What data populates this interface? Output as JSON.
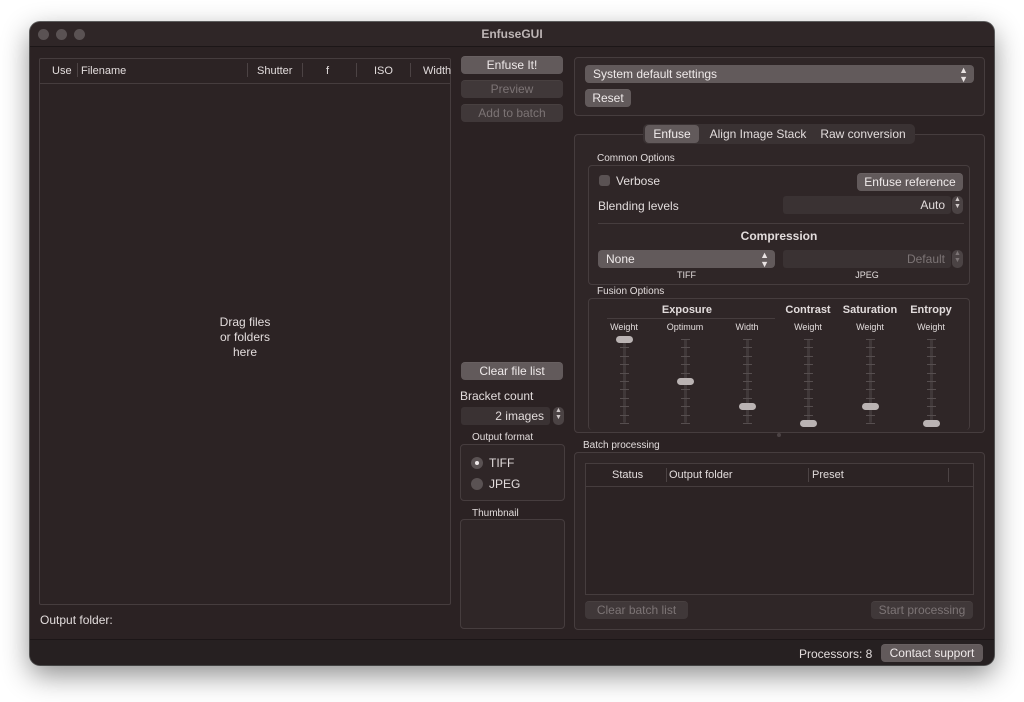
{
  "window": {
    "title": "EnfuseGUI"
  },
  "file_table": {
    "columns": [
      "Use",
      "Filename",
      "Shutter",
      "f",
      "ISO",
      "Width"
    ],
    "drop_hint": [
      "Drag files",
      "or folders",
      "here"
    ]
  },
  "output_folder_label": "Output folder:",
  "actions": {
    "enfuse": "Enfuse It!",
    "preview": "Preview",
    "add_to_batch": "Add to batch",
    "clear_file_list": "Clear file list"
  },
  "bracket": {
    "label": "Bracket count",
    "value": "2 images"
  },
  "output_format": {
    "title": "Output format",
    "options": [
      "TIFF",
      "JPEG"
    ],
    "selected": "TIFF"
  },
  "thumbnail": {
    "title": "Thumbnail"
  },
  "settings": {
    "preset": "System default settings",
    "reset": "Reset"
  },
  "tabs": [
    {
      "label": "Enfuse",
      "active": true
    },
    {
      "label": "Align Image Stack",
      "active": false
    },
    {
      "label": "Raw conversion",
      "active": false
    }
  ],
  "common_options": {
    "title": "Common Options",
    "verbose": "Verbose",
    "verbose_checked": false,
    "enfuse_reference": "Enfuse reference",
    "blending_levels_label": "Blending levels",
    "blending_levels_value": "Auto",
    "compression_title": "Compression",
    "tiff_value": "None",
    "tiff_label": "TIFF",
    "jpeg_value": "Default",
    "jpeg_label": "JPEG"
  },
  "fusion_options": {
    "title": "Fusion Options",
    "groups": [
      "Exposure",
      "Contrast",
      "Saturation",
      "Entropy"
    ],
    "sliders": [
      {
        "label": "Weight",
        "level": 1.0
      },
      {
        "label": "Optimum",
        "level": 0.5
      },
      {
        "label": "Width",
        "level": 0.2
      },
      {
        "label": "Weight",
        "level": 0.0
      },
      {
        "label": "Weight",
        "level": 0.2
      },
      {
        "label": "Weight",
        "level": 0.0
      }
    ]
  },
  "batch": {
    "title": "Batch processing",
    "columns": [
      "Status",
      "Output folder",
      "Preset"
    ],
    "clear": "Clear batch list",
    "start": "Start processing"
  },
  "status_bar": {
    "processors": "Processors: 8",
    "contact": "Contact support"
  },
  "colors": {
    "window_bg": "#2b2223",
    "button": "#625a5b",
    "slider_knob": "#bab3b3"
  }
}
